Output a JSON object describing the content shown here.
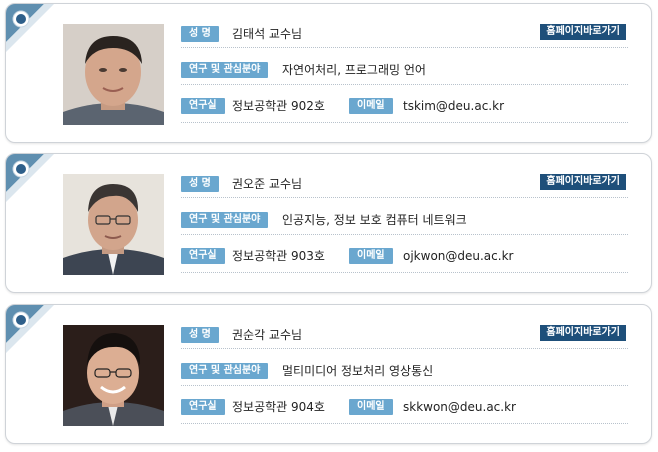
{
  "labels": {
    "name": "성 명",
    "research": "연구 및 관심분야",
    "office": "연구실",
    "email": "이메일",
    "homepage": "홈페이지바로가기"
  },
  "colors": {
    "label_bg": "#6aa7cf",
    "button_bg": "#1e4f7a",
    "corner": "#5f8fb0",
    "border": "#cfd3d8"
  },
  "professors": [
    {
      "name": "김태석 교수님",
      "research": "자연어처리, 프로그래밍 언어",
      "office": "정보공학관 902호",
      "email": "tskim@deu.ac.kr"
    },
    {
      "name": "권오준 교수님",
      "research": "인공지능, 정보 보호 컴퓨터 네트워크",
      "office": "정보공학관 903호",
      "email": "ojkwon@deu.ac.kr"
    },
    {
      "name": "권순각 교수님",
      "research": "멀티미디어 정보처리 영상통신",
      "office": "정보공학관 904호",
      "email": "skkwon@deu.ac.kr"
    }
  ]
}
